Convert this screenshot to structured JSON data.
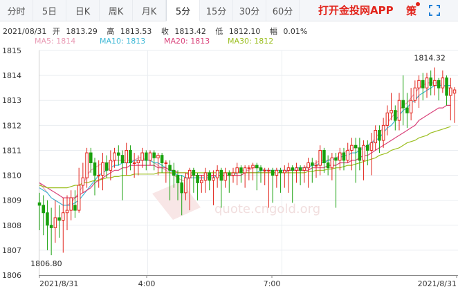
{
  "tabs": [
    {
      "label": "分时",
      "active": false
    },
    {
      "label": "5日",
      "active": false
    },
    {
      "label": "日K",
      "active": false
    },
    {
      "label": "周K",
      "active": false
    },
    {
      "label": "月K",
      "active": false
    },
    {
      "label": "5分",
      "active": true
    },
    {
      "label": "15分",
      "active": false
    },
    {
      "label": "30分",
      "active": false
    },
    {
      "label": "60分",
      "active": false
    }
  ],
  "promo_text": "打开金投网APP",
  "strategy_label": "策",
  "header": {
    "date": "2021/08/31",
    "open_label": "开",
    "open": "1813.29",
    "high_label": "高",
    "high": "1813.53",
    "close_label": "收",
    "close": "1813.42",
    "low_label": "低",
    "low": "1812.10",
    "change_label": "幅",
    "change": "0.01%"
  },
  "ma_legend": [
    {
      "label": "MA5: 1814",
      "color": "#e99ab4"
    },
    {
      "label": "MA10: 1813",
      "color": "#3fb8d6"
    },
    {
      "label": "MA20: 1813",
      "color": "#d9427a"
    },
    {
      "label": "MA30: 1812",
      "color": "#9bbe1f"
    }
  ],
  "watermark": "quote.cngold.org",
  "colors": {
    "up": "#e2231a",
    "down": "#18a10d",
    "grid": "#eaedf1"
  },
  "chart_data": {
    "type": "candlestick",
    "interval": "5分",
    "ylim": [
      1806,
      1815
    ],
    "y_ticks": [
      "1815",
      "1814",
      "1813",
      "1812",
      "1811",
      "1810",
      "1809",
      "1808",
      "1807",
      "1806"
    ],
    "x_ticks": [
      "2021/8/31",
      "4:00",
      "7:00",
      "2021/8/31"
    ],
    "annotations": [
      {
        "label": "1814.32",
        "value": 1814.32,
        "kind": "high"
      },
      {
        "label": "1806.80",
        "value": 1806.8,
        "kind": "low"
      }
    ],
    "candles": [
      [
        1808.9,
        1808.8,
        1809.3,
        1807.8
      ],
      [
        1808.8,
        1808.5,
        1809.2,
        1807.6
      ],
      [
        1808.5,
        1808.0,
        1809.0,
        1807.0
      ],
      [
        1808.0,
        1807.9,
        1808.7,
        1806.8
      ],
      [
        1807.9,
        1808.3,
        1809.0,
        1807.3
      ],
      [
        1808.3,
        1808.2,
        1808.8,
        1807.5
      ],
      [
        1808.2,
        1808.5,
        1809.1,
        1806.9
      ],
      [
        1808.5,
        1808.6,
        1809.2,
        1807.8
      ],
      [
        1808.6,
        1809.1,
        1809.4,
        1808.2
      ],
      [
        1808.8,
        1808.6,
        1809.4,
        1808.3
      ],
      [
        1808.6,
        1809.6,
        1810.3,
        1808.5
      ],
      [
        1809.6,
        1809.9,
        1810.5,
        1809.3
      ],
      [
        1809.9,
        1810.9,
        1811.1,
        1809.5
      ],
      [
        1810.9,
        1810.5,
        1811.1,
        1810.1
      ],
      [
        1810.5,
        1810.0,
        1810.7,
        1809.2
      ],
      [
        1810.0,
        1810.0,
        1810.6,
        1809.5
      ],
      [
        1810.0,
        1810.5,
        1810.9,
        1809.4
      ],
      [
        1810.5,
        1810.2,
        1810.8,
        1809.9
      ],
      [
        1810.2,
        1810.6,
        1811.0,
        1809.8
      ],
      [
        1810.6,
        1810.9,
        1811.1,
        1810.3
      ],
      [
        1810.9,
        1810.8,
        1811.2,
        1810.4
      ],
      [
        1810.8,
        1810.5,
        1811.0,
        1809.0
      ],
      [
        1810.5,
        1811.0,
        1811.3,
        1810.0
      ],
      [
        1811.0,
        1810.5,
        1811.2,
        1810.2
      ],
      [
        1810.5,
        1810.5,
        1810.9,
        1809.9
      ],
      [
        1810.5,
        1810.6,
        1810.8,
        1810.0
      ],
      [
        1810.6,
        1810.9,
        1811.1,
        1810.3
      ],
      [
        1810.9,
        1810.6,
        1811.0,
        1810.2
      ],
      [
        1810.6,
        1810.9,
        1811.0,
        1810.4
      ],
      [
        1810.9,
        1810.7,
        1811.0,
        1810.2
      ],
      [
        1810.7,
        1810.8,
        1810.9,
        1810.0
      ],
      [
        1810.8,
        1810.5,
        1810.9,
        1810.1
      ],
      [
        1810.5,
        1810.5,
        1810.6,
        1809.7
      ],
      [
        1810.4,
        1810.2,
        1810.6,
        1809.0
      ],
      [
        1810.2,
        1810.0,
        1810.5,
        1809.5
      ],
      [
        1810.0,
        1809.7,
        1810.2,
        1809.0
      ],
      [
        1809.7,
        1809.3,
        1810.0,
        1808.4
      ],
      [
        1809.3,
        1809.9,
        1810.1,
        1809.0
      ],
      [
        1809.9,
        1810.2,
        1810.3,
        1808.6
      ],
      [
        1810.2,
        1810.0,
        1810.3,
        1809.3
      ],
      [
        1810.0,
        1809.7,
        1810.1,
        1809.0
      ],
      [
        1809.7,
        1809.8,
        1810.0,
        1809.3
      ],
      [
        1809.8,
        1810.1,
        1810.3,
        1809.3
      ],
      [
        1810.1,
        1809.8,
        1810.2,
        1809.4
      ],
      [
        1809.8,
        1809.9,
        1810.2,
        1808.8
      ],
      [
        1809.9,
        1810.2,
        1810.4,
        1809.5
      ],
      [
        1810.2,
        1809.8,
        1810.3,
        1808.7
      ],
      [
        1809.8,
        1810.1,
        1810.3,
        1809.5
      ],
      [
        1810.1,
        1810.0,
        1810.2,
        1809.3
      ],
      [
        1810.0,
        1810.1,
        1810.3,
        1809.7
      ],
      [
        1810.1,
        1810.3,
        1810.5,
        1809.6
      ],
      [
        1810.3,
        1810.1,
        1810.4,
        1809.7
      ],
      [
        1810.1,
        1810.3,
        1810.4,
        1809.5
      ],
      [
        1810.3,
        1810.3,
        1810.4,
        1809.8
      ],
      [
        1810.3,
        1810.4,
        1810.5,
        1809.8
      ],
      [
        1810.4,
        1810.3,
        1810.5,
        1809.4
      ],
      [
        1810.3,
        1810.2,
        1810.4,
        1809.7
      ],
      [
        1810.2,
        1810.2,
        1810.3,
        1809.6
      ],
      [
        1810.2,
        1810.2,
        1810.3,
        1808.7
      ],
      [
        1810.2,
        1810.0,
        1810.3,
        1808.9
      ],
      [
        1810.0,
        1810.2,
        1810.3,
        1809.5
      ],
      [
        1810.2,
        1810.1,
        1810.3,
        1809.3
      ],
      [
        1810.1,
        1810.2,
        1810.4,
        1809.5
      ],
      [
        1810.2,
        1810.3,
        1810.5,
        1809.3
      ],
      [
        1810.3,
        1810.2,
        1810.4,
        1808.9
      ],
      [
        1810.2,
        1810.3,
        1810.5,
        1809.7
      ],
      [
        1810.3,
        1810.2,
        1810.4,
        1809.6
      ],
      [
        1810.2,
        1810.3,
        1810.4,
        1809.7
      ],
      [
        1810.3,
        1810.5,
        1810.7,
        1809.5
      ],
      [
        1810.5,
        1810.4,
        1810.7,
        1809.7
      ],
      [
        1810.4,
        1810.4,
        1810.6,
        1809.9
      ],
      [
        1810.4,
        1811.0,
        1811.2,
        1810.0
      ],
      [
        1811.0,
        1810.5,
        1811.1,
        1810.1
      ],
      [
        1810.5,
        1810.3,
        1810.8,
        1810.0
      ],
      [
        1810.3,
        1810.7,
        1810.9,
        1809.8
      ],
      [
        1810.7,
        1810.6,
        1810.9,
        1808.7
      ],
      [
        1810.6,
        1810.9,
        1811.1,
        1810.2
      ],
      [
        1810.9,
        1810.6,
        1811.1,
        1810.2
      ],
      [
        1810.6,
        1811.0,
        1811.3,
        1810.5
      ],
      [
        1811.0,
        1811.2,
        1811.5,
        1810.2
      ],
      [
        1811.2,
        1811.1,
        1811.5,
        1809.7
      ],
      [
        1811.1,
        1810.6,
        1811.5,
        1810.2
      ],
      [
        1810.6,
        1811.2,
        1811.4,
        1809.8
      ],
      [
        1811.2,
        1811.0,
        1811.4,
        1810.4
      ],
      [
        1811.0,
        1811.3,
        1811.7,
        1810.0
      ],
      [
        1811.3,
        1811.8,
        1812.0,
        1811.0
      ],
      [
        1811.8,
        1811.4,
        1812.0,
        1810.9
      ],
      [
        1811.4,
        1812.0,
        1812.3,
        1811.1
      ],
      [
        1812.0,
        1812.5,
        1812.8,
        1811.6
      ],
      [
        1812.5,
        1812.6,
        1813.3,
        1812.2
      ],
      [
        1812.6,
        1812.2,
        1812.8,
        1811.8
      ],
      [
        1812.2,
        1813.0,
        1813.3,
        1811.8
      ],
      [
        1813.0,
        1812.7,
        1814.0,
        1812.0
      ],
      [
        1812.7,
        1812.5,
        1813.3,
        1811.9
      ],
      [
        1812.5,
        1813.0,
        1813.5,
        1812.2
      ],
      [
        1813.0,
        1813.5,
        1813.8,
        1812.9
      ],
      [
        1813.5,
        1813.8,
        1814.0,
        1812.7
      ],
      [
        1813.8,
        1813.5,
        1814.1,
        1813.0
      ],
      [
        1813.5,
        1813.9,
        1814.1,
        1813.1
      ],
      [
        1813.9,
        1813.6,
        1814.2,
        1813.2
      ],
      [
        1813.6,
        1813.8,
        1814.32,
        1813.2
      ],
      [
        1813.8,
        1813.5,
        1813.9,
        1813.0
      ],
      [
        1813.5,
        1813.9,
        1814.2,
        1813.3
      ],
      [
        1813.9,
        1813.2,
        1814.0,
        1812.8
      ],
      [
        1813.2,
        1813.5,
        1813.9,
        1812.2
      ],
      [
        1813.29,
        1813.42,
        1813.53,
        1812.1
      ]
    ],
    "ma_series": {
      "MA5": [
        1809.7,
        1809.5,
        1809.3,
        1809.1,
        1809.0,
        1808.9,
        1808.8,
        1808.8,
        1808.9,
        1809.1,
        1809.3,
        1809.6,
        1810.0,
        1810.2,
        1810.3,
        1810.4,
        1810.5,
        1810.5,
        1810.5,
        1810.6,
        1810.6,
        1810.6,
        1810.6,
        1810.6,
        1810.6,
        1810.7,
        1810.7,
        1810.6,
        1810.6,
        1810.5,
        1810.4,
        1810.3,
        1810.2,
        1810.1,
        1810.0,
        1809.9,
        1809.8,
        1809.8,
        1809.9,
        1809.9,
        1809.9,
        1809.9,
        1809.9,
        1809.9,
        1810.0,
        1810.0,
        1810.0,
        1810.0,
        1810.0,
        1810.1,
        1810.1,
        1810.2,
        1810.2,
        1810.2,
        1810.3,
        1810.3,
        1810.3,
        1810.2,
        1810.2,
        1810.1,
        1810.1,
        1810.1,
        1810.1,
        1810.2,
        1810.2,
        1810.2,
        1810.3,
        1810.3,
        1810.4,
        1810.4,
        1810.5,
        1810.6,
        1810.6,
        1810.6,
        1810.7,
        1810.7,
        1810.8,
        1810.9,
        1811.0,
        1811.1,
        1811.1,
        1811.1,
        1811.1,
        1811.2,
        1811.3,
        1811.5,
        1811.7,
        1811.9,
        1812.1,
        1812.3,
        1812.5,
        1812.6,
        1812.8,
        1812.9,
        1813.1,
        1813.3,
        1813.5,
        1813.6,
        1813.7,
        1813.7,
        1813.7,
        1813.7,
        1813.6,
        1813.5,
        1813.5
      ],
      "MA10": [
        1809.5,
        1809.4,
        1809.3,
        1809.1,
        1809.0,
        1808.9,
        1808.8,
        1808.8,
        1808.8,
        1808.9,
        1809.0,
        1809.2,
        1809.4,
        1809.6,
        1809.8,
        1810.0,
        1810.1,
        1810.2,
        1810.3,
        1810.4,
        1810.4,
        1810.5,
        1810.5,
        1810.5,
        1810.6,
        1810.6,
        1810.6,
        1810.6,
        1810.6,
        1810.5,
        1810.5,
        1810.4,
        1810.3,
        1810.2,
        1810.1,
        1810.0,
        1810.0,
        1809.9,
        1809.9,
        1809.9,
        1809.9,
        1809.9,
        1809.9,
        1809.9,
        1809.9,
        1810.0,
        1810.0,
        1810.0,
        1810.0,
        1810.0,
        1810.1,
        1810.1,
        1810.1,
        1810.1,
        1810.1,
        1810.1,
        1810.2,
        1810.2,
        1810.2,
        1810.2,
        1810.2,
        1810.2,
        1810.2,
        1810.2,
        1810.2,
        1810.3,
        1810.3,
        1810.3,
        1810.3,
        1810.4,
        1810.4,
        1810.5,
        1810.5,
        1810.6,
        1810.6,
        1810.7,
        1810.7,
        1810.8,
        1810.8,
        1810.9,
        1810.9,
        1811.0,
        1811.1,
        1811.2,
        1811.3,
        1811.4,
        1811.5,
        1811.7,
        1811.9,
        1812.0,
        1812.2,
        1812.4,
        1812.6,
        1812.7,
        1812.9,
        1813.0,
        1813.2,
        1813.3,
        1813.4,
        1813.5,
        1813.6,
        1813.6,
        1813.6,
        1813.6,
        1813.6
      ],
      "MA20": [
        1809.7,
        1809.6,
        1809.5,
        1809.4,
        1809.3,
        1809.2,
        1809.1,
        1809.1,
        1809.1,
        1809.1,
        1809.2,
        1809.3,
        1809.4,
        1809.5,
        1809.7,
        1809.8,
        1809.9,
        1810.0,
        1810.1,
        1810.2,
        1810.2,
        1810.3,
        1810.3,
        1810.4,
        1810.4,
        1810.4,
        1810.4,
        1810.4,
        1810.4,
        1810.4,
        1810.3,
        1810.3,
        1810.3,
        1810.2,
        1810.2,
        1810.1,
        1810.1,
        1810.1,
        1810.0,
        1810.0,
        1810.0,
        1810.0,
        1810.0,
        1810.0,
        1810.0,
        1810.0,
        1810.0,
        1810.0,
        1810.0,
        1810.0,
        1810.0,
        1810.0,
        1810.1,
        1810.1,
        1810.1,
        1810.1,
        1810.1,
        1810.1,
        1810.1,
        1810.1,
        1810.1,
        1810.1,
        1810.1,
        1810.2,
        1810.2,
        1810.2,
        1810.2,
        1810.2,
        1810.2,
        1810.3,
        1810.3,
        1810.3,
        1810.3,
        1810.4,
        1810.4,
        1810.4,
        1810.5,
        1810.5,
        1810.5,
        1810.6,
        1810.6,
        1810.7,
        1810.8,
        1810.8,
        1810.9,
        1811.0,
        1811.1,
        1811.2,
        1811.3,
        1811.4,
        1811.5,
        1811.6,
        1811.7,
        1811.8,
        1811.9,
        1812.0,
        1812.2,
        1812.3,
        1812.4,
        1812.5,
        1812.6,
        1812.7,
        1812.7,
        1812.8,
        1812.8
      ],
      "MA30": [
        1809.6,
        1809.55,
        1809.5,
        1809.5,
        1809.5,
        1809.5,
        1809.5,
        1809.5,
        1809.55,
        1809.6,
        1809.6,
        1809.7,
        1809.7,
        1809.75,
        1809.8,
        1809.8,
        1809.85,
        1809.9,
        1809.9,
        1809.95,
        1809.95,
        1810.0,
        1810.0,
        1810.0,
        1810.05,
        1810.05,
        1810.05,
        1810.05,
        1810.05,
        1810.05,
        1810.1,
        1810.1,
        1810.1,
        1810.1,
        1810.1,
        1810.1,
        1810.1,
        1810.1,
        1810.1,
        1810.1,
        1810.1,
        1810.1,
        1810.1,
        1810.1,
        1810.1,
        1810.1,
        1810.1,
        1810.1,
        1810.1,
        1810.1,
        1810.1,
        1810.1,
        1810.1,
        1810.1,
        1810.1,
        1810.1,
        1810.1,
        1810.1,
        1810.1,
        1810.1,
        1810.1,
        1810.1,
        1810.1,
        1810.1,
        1810.1,
        1810.1,
        1810.1,
        1810.1,
        1810.15,
        1810.15,
        1810.2,
        1810.2,
        1810.2,
        1810.25,
        1810.25,
        1810.3,
        1810.3,
        1810.35,
        1810.4,
        1810.4,
        1810.45,
        1810.5,
        1810.55,
        1810.6,
        1810.65,
        1810.7,
        1810.8,
        1810.85,
        1810.9,
        1811.0,
        1811.05,
        1811.1,
        1811.2,
        1811.3,
        1811.35,
        1811.4,
        1811.5,
        1811.55,
        1811.6,
        1811.7,
        1811.75,
        1811.8,
        1811.85,
        1811.9,
        1811.95
      ]
    }
  }
}
